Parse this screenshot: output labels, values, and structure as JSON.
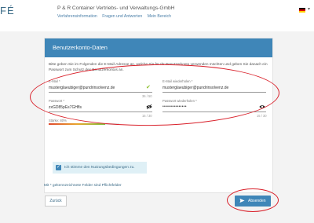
{
  "header": {
    "logo_text": "FÉ",
    "company": "P & R Container Vertriebs- und Verwaltungs-GmbH",
    "nav": [
      "Verfahrensinformation",
      "Fragen und Antworten",
      "Mein Bereich"
    ],
    "language_flag": "german-flag-icon",
    "language_dropdown": "chevron-down-icon"
  },
  "card": {
    "title": "Benutzerkonto-Daten",
    "intro": "Bitte geben Sie im Folgenden die E-Mail-Adresse an, welche Sie für Ihr Benutzerkonto verwenden möchten und geben Sie danach ein Passwort zum Schutz des Benutzerkontos an."
  },
  "form": {
    "email": {
      "label": "E-Mail *",
      "value": "musterglaeubiger@pundrinsolvenz.de",
      "counter": "36 / 50",
      "valid": true
    },
    "email_repeat": {
      "label": "E-Mail wiederholen *",
      "value": "musterglaeubiger@pundrinsolvenz.de"
    },
    "password": {
      "label": "Passwort *",
      "value": "zxGD85pEs7GHfls",
      "counter": "15 / 30"
    },
    "password_repeat": {
      "label": "Passwort wiederholen *",
      "value": "•••••••••••••••",
      "counter": "15 / 30"
    },
    "strength": {
      "label": "Stärke: 80%",
      "fraction": 0.8
    },
    "terms": {
      "label": "Ich stimme den Nutzungsbedingungen zu.",
      "checked": true
    }
  },
  "required_note": "Mit * gekennzeichnete Felder sind Pflichtfelder",
  "actions": {
    "back": "Zurück",
    "submit": "Absenden"
  },
  "colors": {
    "primary": "#3f86b8",
    "annotation": "#d9202a",
    "valid": "#8cbf2a"
  }
}
